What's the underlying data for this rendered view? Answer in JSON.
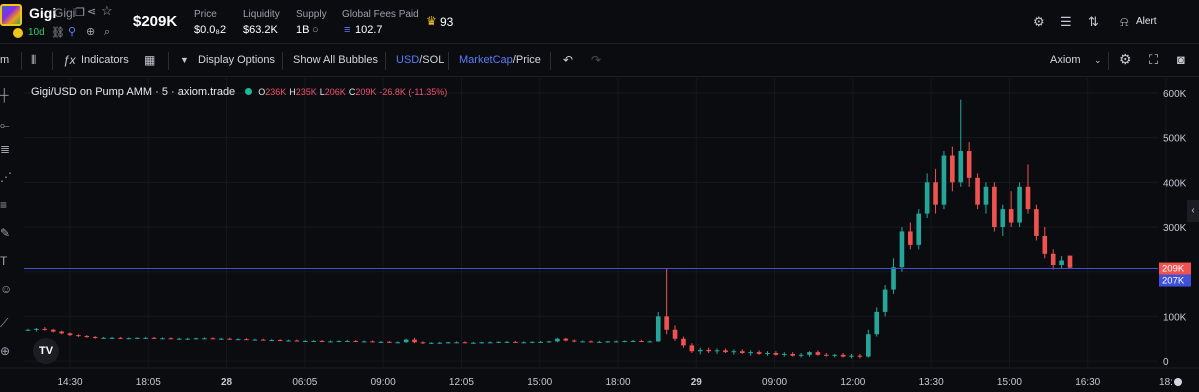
{
  "header": {
    "token_name": "Gigi",
    "token_ticker": "Gigi",
    "age": "10d",
    "market_cap": "$209K",
    "stats": [
      {
        "label": "Price",
        "value": "$0.0₈2"
      },
      {
        "label": "Liquidity",
        "value": "$63.2K"
      },
      {
        "label": "Supply",
        "value": "1B"
      },
      {
        "label": "Global Fees Paid",
        "value": "102.7"
      }
    ],
    "holders_count": "93",
    "alert_label": "Alert",
    "icons": [
      "copy-icon",
      "share-icon",
      "star-icon",
      "link-icon",
      "user-icon",
      "globe-icon",
      "search-icon",
      "settings-icon",
      "list-icon",
      "sort-icon",
      "bell-icon"
    ]
  },
  "toolbar": {
    "partial_left": "m",
    "indicators": "Indicators",
    "display_options": "Display Options",
    "show_all_bubbles": "Show All Bubbles",
    "usd": "USD",
    "sol": "SOL",
    "marketcap": "MarketCap",
    "price": "Price",
    "source": "Axiom"
  },
  "legend": {
    "title": "Gigi/USD on Pump AMM · 5 · axiom.trade",
    "o_label": "O",
    "o_value": "236K",
    "h_label": "H",
    "h_value": "235K",
    "l_label": "L",
    "l_value": "206K",
    "c_label": "C",
    "c_value": "209K",
    "change": "-26.8K (-11.35%)"
  },
  "tv_logo": "TV",
  "colors": {
    "up": "#26a69a",
    "down": "#ef5350",
    "price_line": "#3f51d8",
    "accent": "#5b7cfa",
    "background": "#0b0c10"
  },
  "chart_data": {
    "type": "candlestick",
    "y_unit": "market cap (USD)",
    "yticks": [
      "600K",
      "500K",
      "400K",
      "300K",
      "200K",
      "100K",
      "0"
    ],
    "ytick_values": [
      600000,
      500000,
      400000,
      300000,
      200000,
      100000,
      0
    ],
    "ylim": [
      -20000,
      620000
    ],
    "xticks": [
      "14:30",
      "18:05",
      "28",
      "06:05",
      "09:00",
      "12:05",
      "15:00",
      "18:00",
      "29",
      "09:00",
      "12:00",
      "13:30",
      "15:00",
      "16:30",
      "18:"
    ],
    "bold_xticks": [
      "28",
      "29"
    ],
    "current_value_label": "209K",
    "price_line_label": "207K",
    "price_line_value": 207000,
    "candles": [
      [
        70000,
        72000,
        68000,
        70000
      ],
      [
        70000,
        74000,
        66000,
        72000
      ],
      [
        72000,
        76000,
        68000,
        70000
      ],
      [
        70000,
        72000,
        64000,
        66000
      ],
      [
        66000,
        68000,
        60000,
        62000
      ],
      [
        62000,
        64000,
        56000,
        58000
      ],
      [
        58000,
        60000,
        54000,
        56000
      ],
      [
        56000,
        58000,
        52000,
        54000
      ],
      [
        54000,
        56000,
        50000,
        52000
      ],
      [
        52000,
        54000,
        50000,
        52000
      ],
      [
        52000,
        54000,
        50000,
        52000
      ],
      [
        52000,
        54000,
        50000,
        51000
      ],
      [
        51000,
        53000,
        49000,
        51000
      ],
      [
        51000,
        53000,
        49000,
        52000
      ],
      [
        52000,
        54000,
        50000,
        52000
      ],
      [
        52000,
        54000,
        50000,
        51000
      ],
      [
        51000,
        53000,
        49000,
        51000
      ],
      [
        51000,
        53000,
        49000,
        50000
      ],
      [
        50000,
        52000,
        48000,
        50000
      ],
      [
        50000,
        52000,
        48000,
        50000
      ],
      [
        50000,
        52000,
        48000,
        51000
      ],
      [
        51000,
        53000,
        49000,
        51000
      ],
      [
        51000,
        53000,
        49000,
        50000
      ],
      [
        50000,
        52000,
        48000,
        50000
      ],
      [
        50000,
        52000,
        48000,
        49000
      ],
      [
        49000,
        51000,
        47000,
        49000
      ],
      [
        49000,
        51000,
        47000,
        48000
      ],
      [
        48000,
        50000,
        46000,
        48000
      ],
      [
        48000,
        50000,
        46000,
        47000
      ],
      [
        47000,
        49000,
        45000,
        47000
      ],
      [
        47000,
        49000,
        45000,
        46000
      ],
      [
        46000,
        48000,
        44000,
        46000
      ],
      [
        46000,
        48000,
        44000,
        45000
      ],
      [
        45000,
        47000,
        43000,
        45000
      ],
      [
        45000,
        47000,
        43000,
        45000
      ],
      [
        45000,
        47000,
        43000,
        44000
      ],
      [
        44000,
        46000,
        42000,
        44000
      ],
      [
        44000,
        46000,
        42000,
        45000
      ],
      [
        45000,
        47000,
        43000,
        45000
      ],
      [
        45000,
        47000,
        43000,
        44000
      ],
      [
        44000,
        46000,
        42000,
        44000
      ],
      [
        44000,
        46000,
        42000,
        43000
      ],
      [
        43000,
        45000,
        41000,
        43000
      ],
      [
        43000,
        45000,
        41000,
        42000
      ],
      [
        42000,
        44000,
        40000,
        42000
      ],
      [
        42000,
        50000,
        41000,
        48000
      ],
      [
        48000,
        52000,
        40000,
        42000
      ],
      [
        42000,
        44000,
        38000,
        40000
      ],
      [
        40000,
        42000,
        38000,
        41000
      ],
      [
        41000,
        43000,
        39000,
        41000
      ],
      [
        41000,
        43000,
        39000,
        42000
      ],
      [
        42000,
        44000,
        40000,
        42000
      ],
      [
        42000,
        44000,
        40000,
        41000
      ],
      [
        41000,
        43000,
        39000,
        41000
      ],
      [
        41000,
        43000,
        39000,
        42000
      ],
      [
        42000,
        44000,
        40000,
        42000
      ],
      [
        42000,
        44000,
        40000,
        43000
      ],
      [
        43000,
        45000,
        41000,
        43000
      ],
      [
        43000,
        45000,
        41000,
        42000
      ],
      [
        42000,
        44000,
        40000,
        42000
      ],
      [
        42000,
        44000,
        40000,
        43000
      ],
      [
        43000,
        45000,
        41000,
        43000
      ],
      [
        43000,
        45000,
        41000,
        44000
      ],
      [
        44000,
        52000,
        42000,
        50000
      ],
      [
        50000,
        52000,
        44000,
        46000
      ],
      [
        46000,
        48000,
        42000,
        44000
      ],
      [
        44000,
        46000,
        42000,
        44000
      ],
      [
        44000,
        46000,
        42000,
        43000
      ],
      [
        43000,
        45000,
        41000,
        43000
      ],
      [
        43000,
        45000,
        41000,
        44000
      ],
      [
        44000,
        46000,
        42000,
        44000
      ],
      [
        44000,
        46000,
        42000,
        45000
      ],
      [
        45000,
        47000,
        43000,
        45000
      ],
      [
        45000,
        47000,
        43000,
        44000
      ],
      [
        44000,
        46000,
        42000,
        44000
      ],
      [
        44000,
        110000,
        43000,
        100000
      ],
      [
        100000,
        208000,
        60000,
        70000
      ],
      [
        70000,
        80000,
        45000,
        50000
      ],
      [
        50000,
        55000,
        30000,
        35000
      ],
      [
        35000,
        40000,
        18000,
        22000
      ],
      [
        22000,
        30000,
        15000,
        25000
      ],
      [
        25000,
        30000,
        18000,
        22000
      ],
      [
        22000,
        28000,
        16000,
        24000
      ],
      [
        24000,
        28000,
        18000,
        20000
      ],
      [
        20000,
        26000,
        14000,
        22000
      ],
      [
        22000,
        26000,
        16000,
        18000
      ],
      [
        18000,
        24000,
        12000,
        20000
      ],
      [
        20000,
        24000,
        14000,
        16000
      ],
      [
        16000,
        22000,
        12000,
        18000
      ],
      [
        18000,
        22000,
        12000,
        14000
      ],
      [
        14000,
        20000,
        10000,
        16000
      ],
      [
        16000,
        20000,
        10000,
        12000
      ],
      [
        12000,
        18000,
        8000,
        14000
      ],
      [
        14000,
        22000,
        10000,
        20000
      ],
      [
        20000,
        24000,
        12000,
        14000
      ],
      [
        14000,
        18000,
        10000,
        12000
      ],
      [
        12000,
        16000,
        8000,
        14000
      ],
      [
        14000,
        18000,
        8000,
        10000
      ],
      [
        10000,
        16000,
        6000,
        12000
      ],
      [
        12000,
        16000,
        6000,
        10000
      ],
      [
        10000,
        70000,
        8000,
        60000
      ],
      [
        60000,
        120000,
        55000,
        110000
      ],
      [
        110000,
        170000,
        100000,
        160000
      ],
      [
        160000,
        230000,
        150000,
        210000
      ],
      [
        210000,
        300000,
        200000,
        290000
      ],
      [
        290000,
        310000,
        250000,
        260000
      ],
      [
        260000,
        340000,
        250000,
        330000
      ],
      [
        330000,
        420000,
        320000,
        400000
      ],
      [
        400000,
        430000,
        330000,
        350000
      ],
      [
        350000,
        470000,
        340000,
        460000
      ],
      [
        460000,
        480000,
        380000,
        400000
      ],
      [
        400000,
        585000,
        390000,
        470000
      ],
      [
        470000,
        490000,
        390000,
        410000
      ],
      [
        410000,
        420000,
        340000,
        350000
      ],
      [
        350000,
        400000,
        330000,
        390000
      ],
      [
        390000,
        400000,
        290000,
        300000
      ],
      [
        300000,
        350000,
        280000,
        340000
      ],
      [
        340000,
        380000,
        300000,
        310000
      ],
      [
        310000,
        400000,
        300000,
        390000
      ],
      [
        390000,
        440000,
        330000,
        340000
      ],
      [
        340000,
        350000,
        270000,
        280000
      ],
      [
        280000,
        300000,
        230000,
        240000
      ],
      [
        240000,
        250000,
        205000,
        215000
      ],
      [
        215000,
        235000,
        206000,
        225000
      ],
      [
        236000,
        235000,
        206000,
        209000
      ]
    ]
  }
}
